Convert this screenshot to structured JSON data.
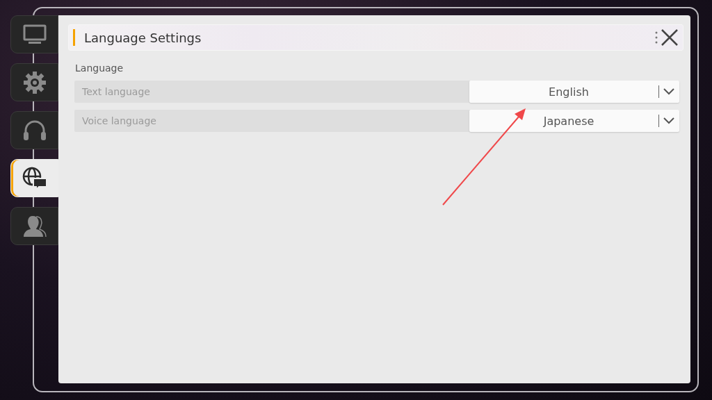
{
  "tabs": [
    {
      "kind": "display",
      "selected": false
    },
    {
      "kind": "settings",
      "selected": false
    },
    {
      "kind": "audio",
      "selected": false
    },
    {
      "kind": "language",
      "selected": true
    },
    {
      "kind": "account",
      "selected": false
    }
  ],
  "header": {
    "title": "Language Settings"
  },
  "section": {
    "title": "Language"
  },
  "settings": [
    {
      "label": "Text language",
      "value": "English"
    },
    {
      "label": "Voice language",
      "value": "Japanese"
    }
  ]
}
